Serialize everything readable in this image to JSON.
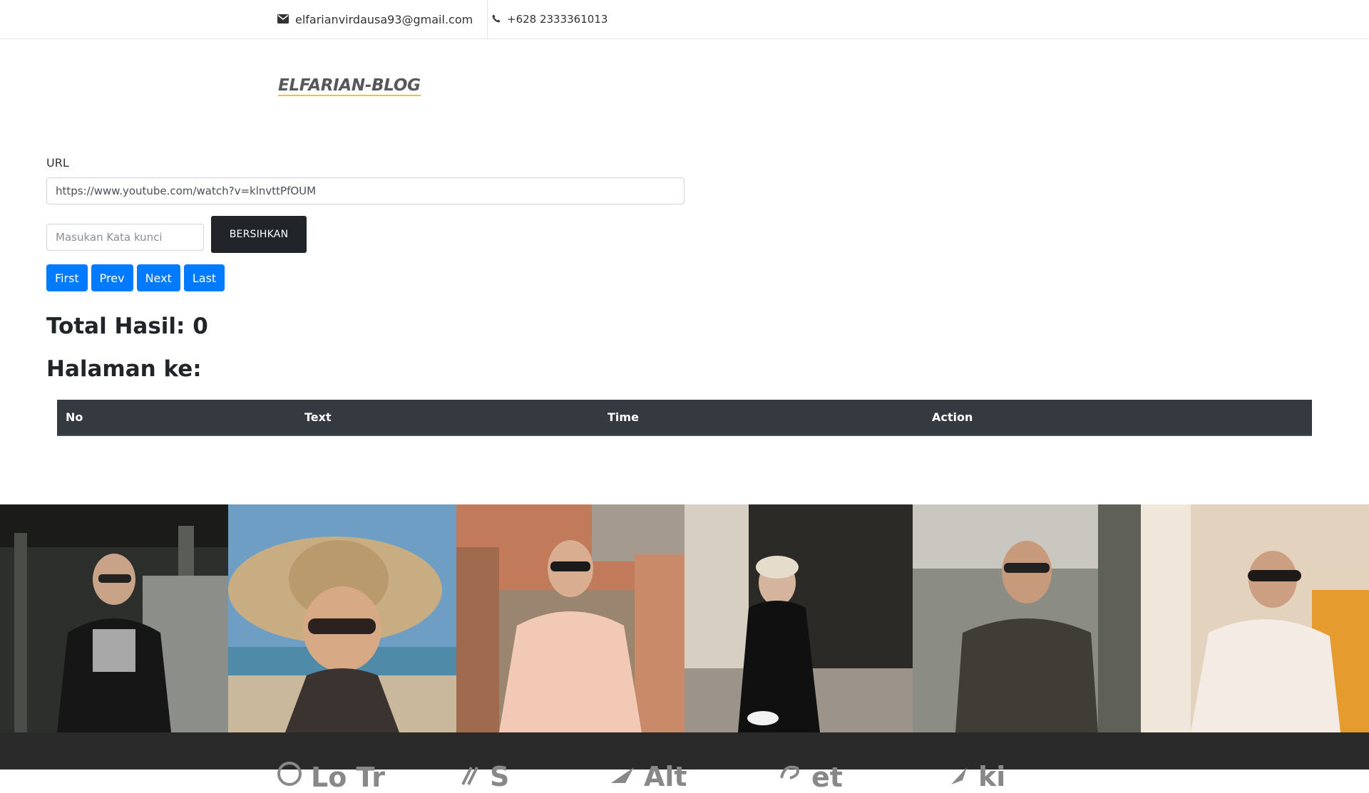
{
  "topbar": {
    "email": "elfarianvirdausa93@gmail.com",
    "phone": "+628 2333361013"
  },
  "logo": {
    "text": "ELFARIAN-BLOG"
  },
  "form": {
    "url_label": "URL",
    "url_value": "https://www.youtube.com/watch?v=klnvttPfOUM",
    "keyword_placeholder": "Masukan Kata kunci",
    "clear_button": "BERSIHKAN"
  },
  "pager": {
    "first": "First",
    "prev": "Prev",
    "next": "Next",
    "last": "Last"
  },
  "results": {
    "total_label": "Total Hasil: 0",
    "page_label": "Halaman ke:"
  },
  "table": {
    "headers": [
      "No",
      "Text",
      "Time",
      "Action"
    ]
  },
  "gallery": {
    "photos": [
      "photo-woman-black-jacket",
      "photo-woman-straw-hat",
      "photo-woman-pink-sweater",
      "photo-woman-black-outfit",
      "photo-man-tshirt",
      "photo-woman-turtleneck"
    ]
  },
  "footer": {
    "brands": [
      "Lo Tr",
      "S",
      "Alt",
      "et",
      "ki"
    ]
  },
  "colors": {
    "primary": "#007bff",
    "dark": "#212529",
    "table_header": "#343a40",
    "logo_underline": "#f0c419"
  }
}
